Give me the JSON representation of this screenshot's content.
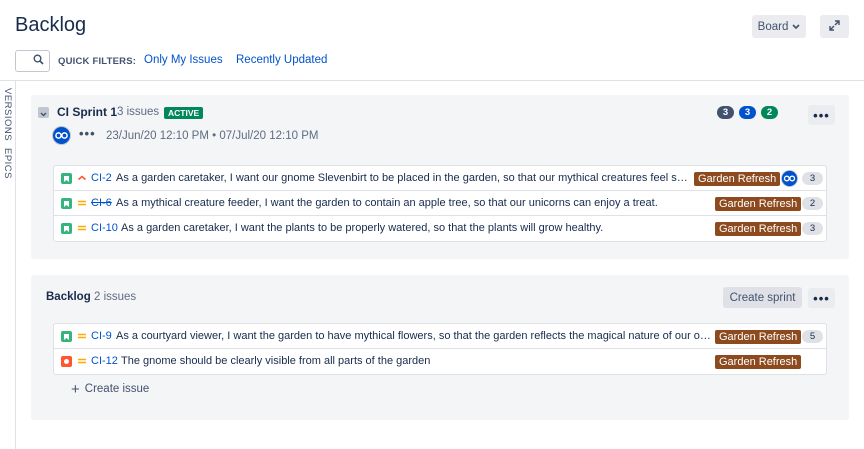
{
  "header": {
    "title": "Backlog",
    "board_label": "Board"
  },
  "filters": {
    "label": "QUICK FILTERS:",
    "items": [
      "Only My Issues",
      "Recently Updated"
    ]
  },
  "side_tabs": [
    "VERSIONS",
    "EPICS"
  ],
  "sprint": {
    "name": "CI Sprint 1",
    "count": "3 issues",
    "status": "ACTIVE",
    "dates": "23/Jun/20 12:10 PM • 07/Jul/20 12:10 PM",
    "badges": [
      {
        "value": "3",
        "color": "#42526e"
      },
      {
        "value": "3",
        "color": "#0052cc"
      },
      {
        "value": "2",
        "color": "#00875a"
      }
    ],
    "issues": [
      {
        "key": "CI-2",
        "summary": "As a garden caretaker, I want our gnome Slevenbirt to be placed in the garden, so that our mythical creatures feel safe...",
        "epic": "Garden Refresh",
        "estimate": "3",
        "type": "story",
        "priority": "high",
        "done": false,
        "has_avatar": true
      },
      {
        "key": "CI-6",
        "summary": "As a mythical creature feeder, I want the garden to contain an apple tree, so that our unicorns can enjoy a treat.",
        "epic": "Garden Refresh",
        "estimate": "2",
        "type": "story",
        "priority": "medium",
        "done": true,
        "has_avatar": false
      },
      {
        "key": "CI-10",
        "summary": "As a garden caretaker, I want the plants to be properly watered, so that the plants will grow healthy.",
        "epic": "Garden Refresh",
        "estimate": "3",
        "type": "story",
        "priority": "medium",
        "done": false,
        "has_avatar": false
      }
    ]
  },
  "backlog": {
    "title": "Backlog",
    "count": "2 issues",
    "create_sprint_label": "Create sprint",
    "create_issue_label": "Create issue",
    "issues": [
      {
        "key": "CI-9",
        "summary": "As a courtyard viewer, I want the garden to have mythical flowers, so that the garden reflects the magical nature of our org...",
        "epic": "Garden Refresh",
        "estimate": "5",
        "type": "story",
        "priority": "medium"
      },
      {
        "key": "CI-12",
        "summary": "The gnome should be clearly visible from all parts of the garden",
        "epic": "Garden Refresh",
        "estimate": "",
        "type": "bug",
        "priority": "medium"
      }
    ]
  },
  "colors": {
    "story": "#36b37e",
    "bug": "#ff5630",
    "priority_high": "#ff5630",
    "priority_medium": "#ffab00",
    "epic": "#8c4a1e",
    "avatar": "#0052cc"
  },
  "icons": [
    "search-icon",
    "chevron-down-icon",
    "expand-icon",
    "story-icon",
    "bug-icon",
    "priority-high-icon",
    "priority-medium-icon",
    "plus-icon",
    "more-icon",
    "avatar-icon"
  ]
}
